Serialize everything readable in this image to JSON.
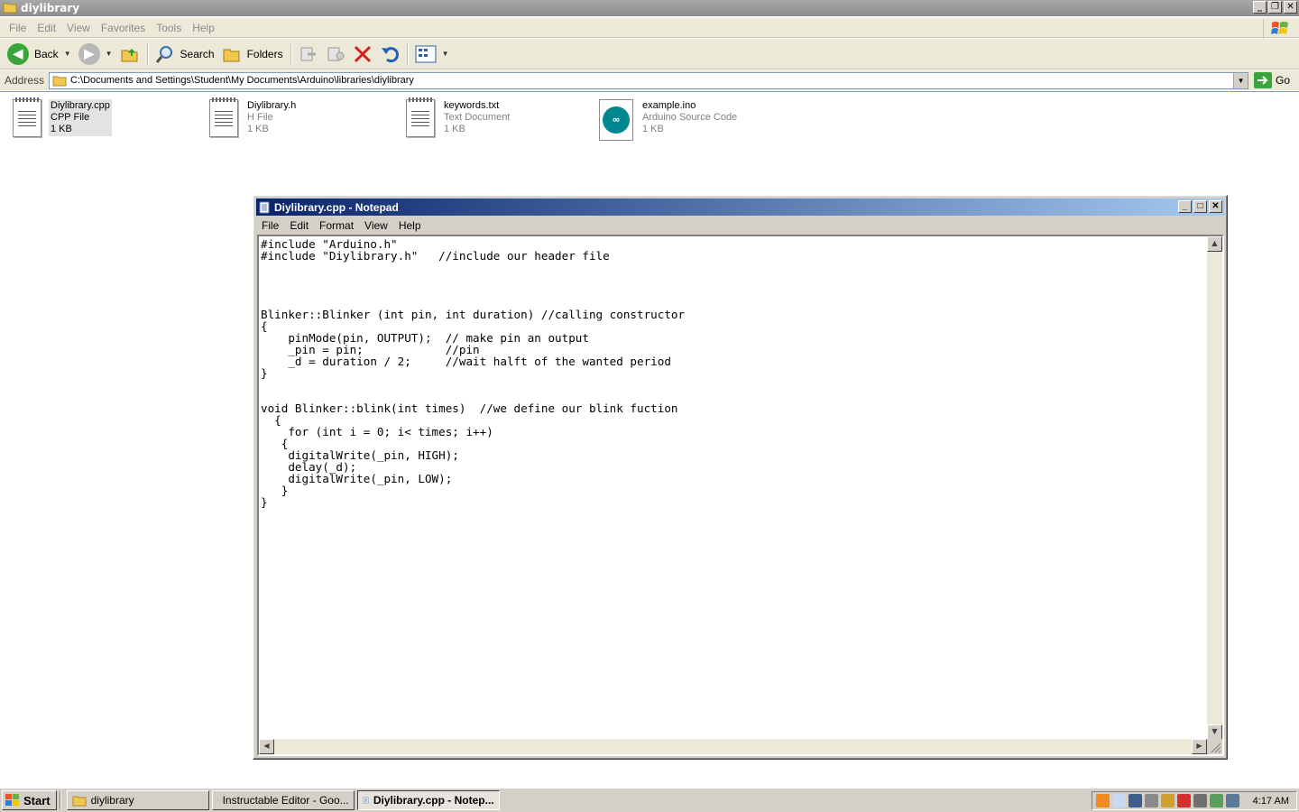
{
  "explorer": {
    "title": "diylibrary",
    "menu": [
      "File",
      "Edit",
      "View",
      "Favorites",
      "Tools",
      "Help"
    ],
    "toolbar": {
      "back_label": "Back",
      "search_label": "Search",
      "folders_label": "Folders"
    },
    "address": {
      "label": "Address",
      "path": "C:\\Documents and Settings\\Student\\My Documents\\Arduino\\libraries\\diylibrary",
      "go_label": "Go"
    },
    "files": [
      {
        "name": "Diylibrary.cpp",
        "type": "CPP File",
        "size": "1 KB",
        "icon": "text-file-icon",
        "selected": true
      },
      {
        "name": "Diylibrary.h",
        "type": "H File",
        "size": "1 KB",
        "icon": "text-file-icon",
        "selected": false
      },
      {
        "name": "keywords.txt",
        "type": "Text Document",
        "size": "1 KB",
        "icon": "text-file-icon",
        "selected": false
      },
      {
        "name": "example.ino",
        "type": "Arduino Source Code",
        "size": "1 KB",
        "icon": "arduino-icon",
        "selected": false
      }
    ]
  },
  "notepad": {
    "title": "Diylibrary.cpp - Notepad",
    "menu": [
      "File",
      "Edit",
      "Format",
      "View",
      "Help"
    ],
    "content": "#include \"Arduino.h\"\n#include \"Diylibrary.h\"   //include our header file\n\n\n\n\nBlinker::Blinker (int pin, int duration) //calling constructor\n{\n    pinMode(pin, OUTPUT);  // make pin an output\n    _pin = pin;            //pin\n    _d = duration / 2;     //wait halft of the wanted period\n}\n\n\nvoid Blinker::blink(int times)  //we define our blink fuction\n  {\n    for (int i = 0; i< times; i++)\n   {\n    digitalWrite(_pin, HIGH);\n    delay(_d);\n    digitalWrite(_pin, LOW);\n   }\n}"
  },
  "taskbar": {
    "start_label": "Start",
    "tasks": [
      {
        "label": "diylibrary",
        "icon": "folder-icon",
        "active": false
      },
      {
        "label": "Instructable Editor - Goo...",
        "icon": "chrome-icon",
        "active": false
      },
      {
        "label": "Diylibrary.cpp - Notep...",
        "icon": "notepad-icon",
        "active": true
      }
    ],
    "clock": "4:17 AM"
  },
  "colors": {
    "active_title": "#0a246a",
    "inactive_title": "#8c8c8c",
    "face": "#d4d0c8",
    "arduino_teal": "#00878f"
  }
}
